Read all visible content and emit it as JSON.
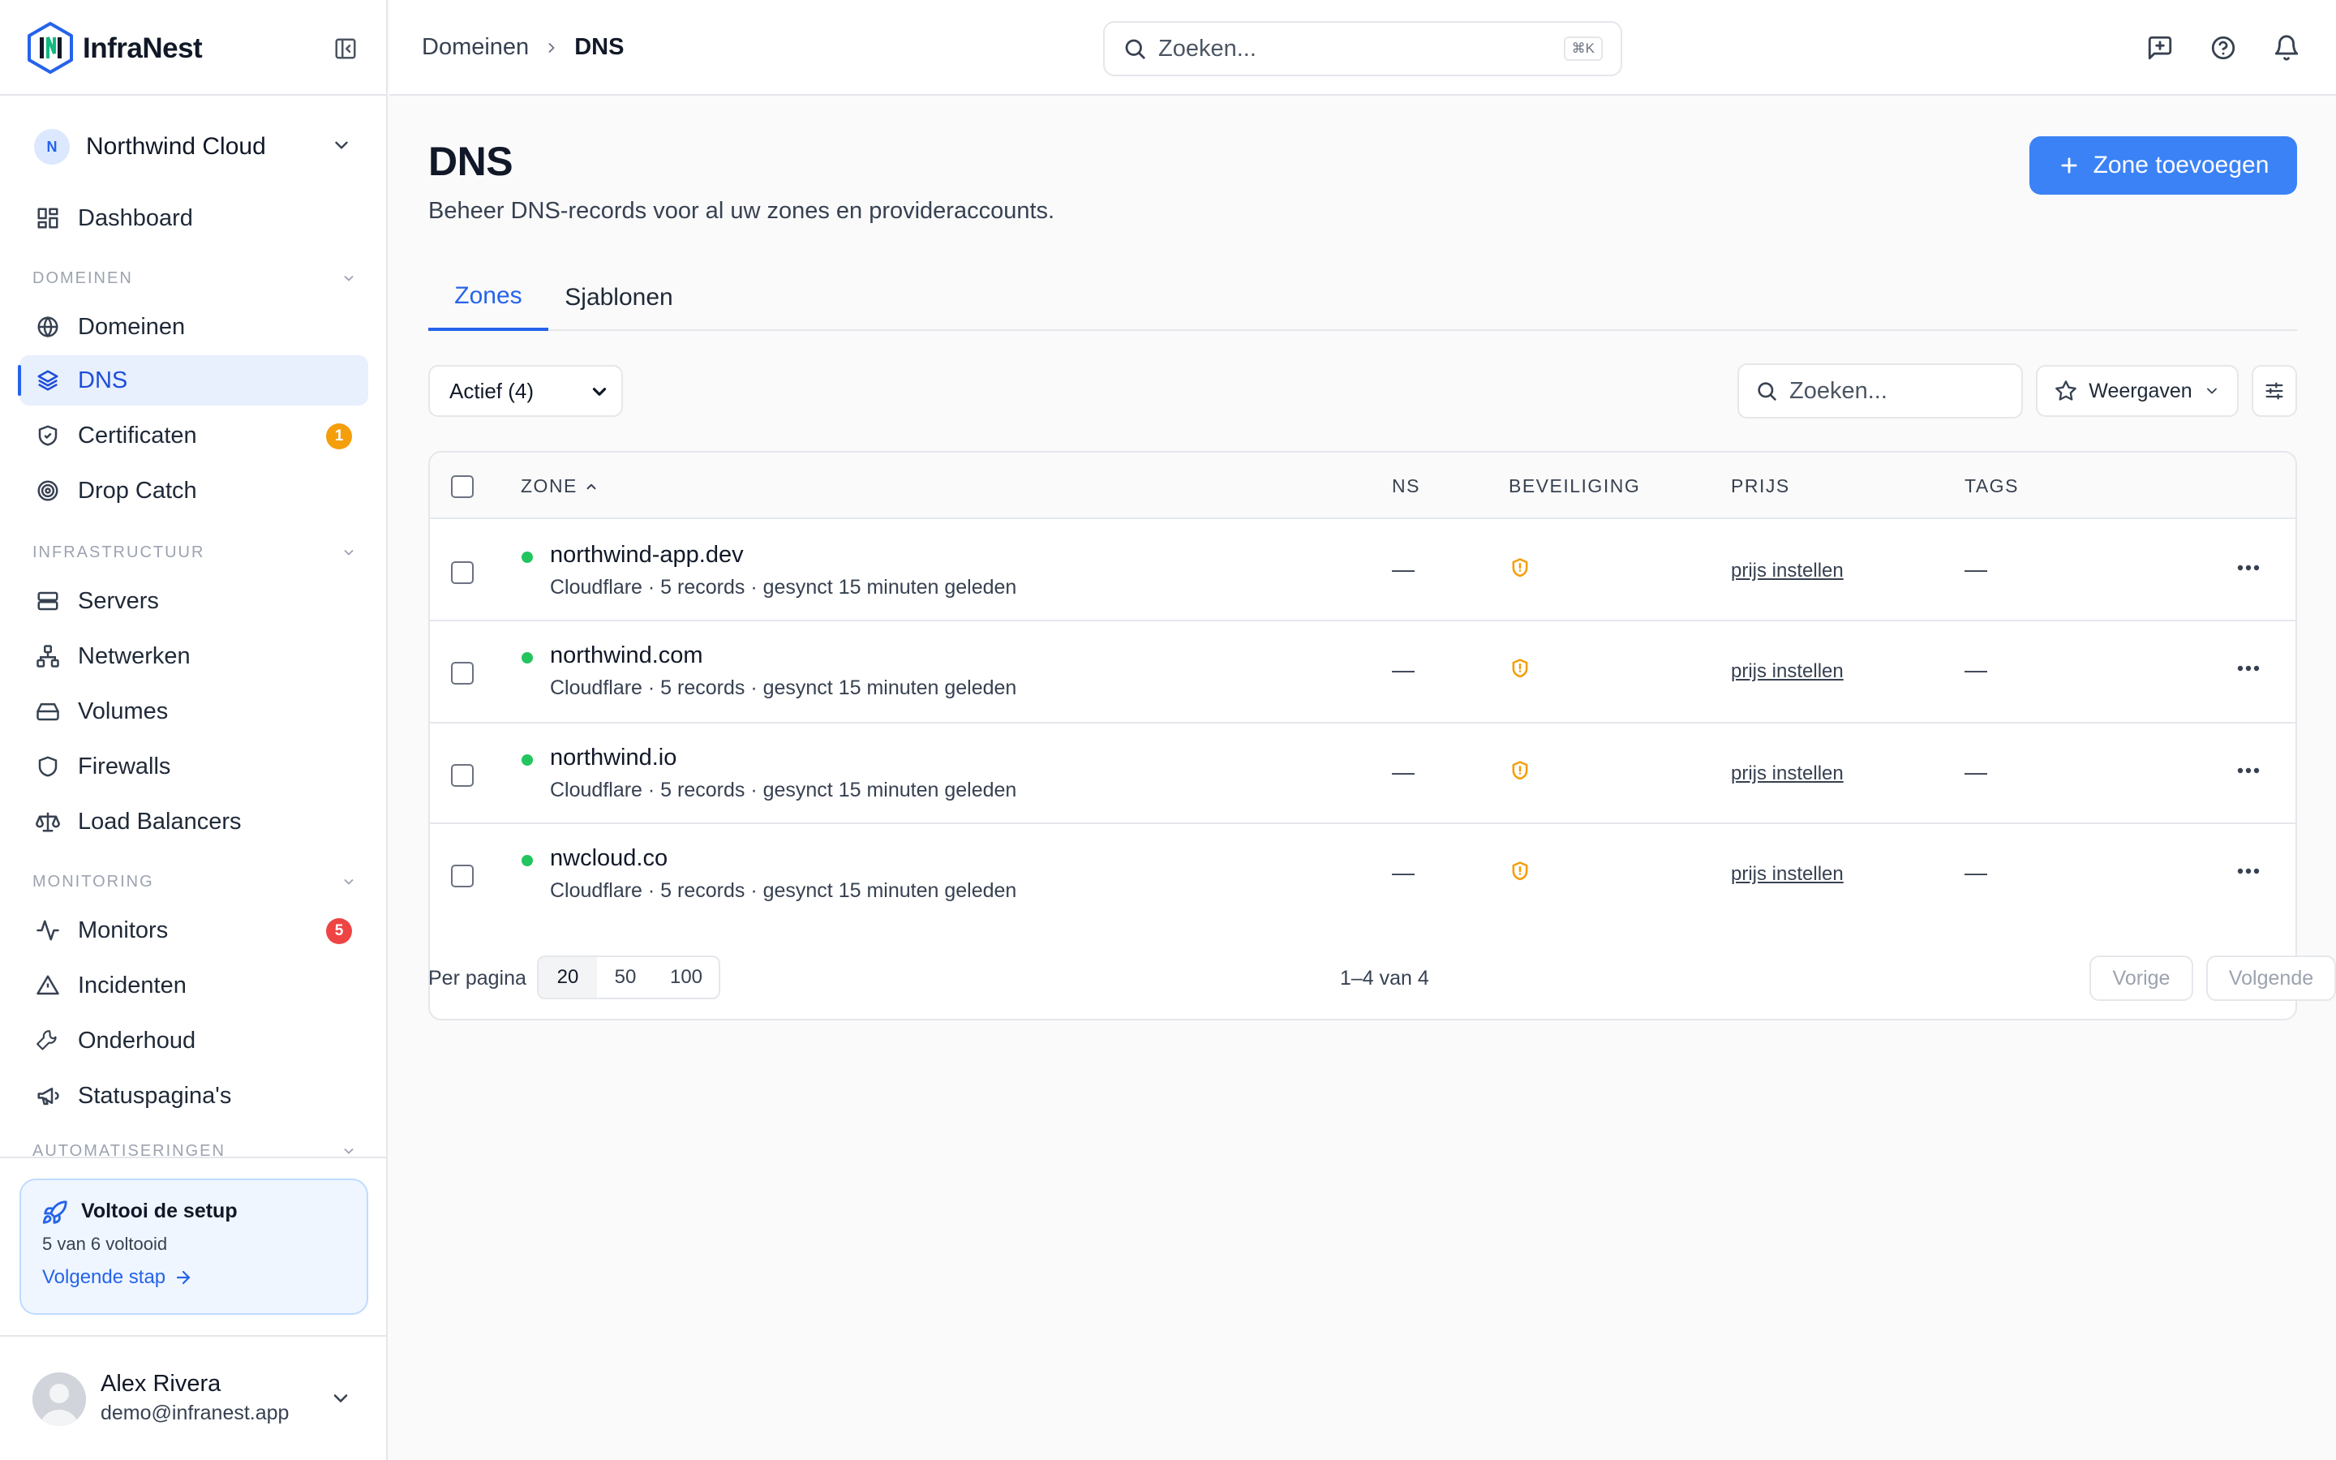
{
  "brand": {
    "name": "InfraNest",
    "accent": "#2563eb"
  },
  "org": {
    "initial": "N",
    "name": "Northwind Cloud"
  },
  "sidebar": {
    "top_item": {
      "label": "Dashboard"
    },
    "sections": [
      {
        "title": "DOMEINEN",
        "items": [
          {
            "label": "Domeinen",
            "icon": "globe-icon"
          },
          {
            "label": "DNS",
            "icon": "layers-icon",
            "active": true
          },
          {
            "label": "Certificaten",
            "icon": "shield-check-icon",
            "badge": "1"
          },
          {
            "label": "Drop Catch",
            "icon": "target-icon"
          }
        ]
      },
      {
        "title": "INFRASTRUCTUUR",
        "items": [
          {
            "label": "Servers",
            "icon": "server-icon"
          },
          {
            "label": "Netwerken",
            "icon": "network-icon"
          },
          {
            "label": "Volumes",
            "icon": "hard-drive-icon"
          },
          {
            "label": "Firewalls",
            "icon": "shield-icon"
          },
          {
            "label": "Load Balancers",
            "icon": "scale-icon"
          }
        ]
      },
      {
        "title": "MONITORING",
        "items": [
          {
            "label": "Monitors",
            "icon": "activity-icon",
            "badge": "5"
          },
          {
            "label": "Incidenten",
            "icon": "alert-triangle-icon"
          },
          {
            "label": "Onderhoud",
            "icon": "wrench-icon"
          },
          {
            "label": "Statuspagina's",
            "icon": "megaphone-icon"
          }
        ]
      },
      {
        "title": "AUTOMATISERINGEN",
        "items": []
      }
    ]
  },
  "setup": {
    "title": "Voltooi de setup",
    "progress": "5 van 6 voltooid",
    "next": "Volgende stap"
  },
  "user": {
    "name": "Alex Rivera",
    "email": "demo@infranest.app"
  },
  "topbar": {
    "breadcrumb": [
      "Domeinen",
      "DNS"
    ],
    "search_placeholder": "Zoeken...",
    "shortcut": "⌘K"
  },
  "page": {
    "title": "DNS",
    "subtitle": "Beheer DNS-records voor al uw zones en provideraccounts.",
    "add_button": "Zone toevoegen",
    "tabs": [
      "Zones",
      "Sjablonen"
    ],
    "active_tab": "Zones"
  },
  "toolbar": {
    "filter_value": "Actief (4)",
    "filter_options": [
      "Actief (4)"
    ],
    "search_placeholder": "Zoeken...",
    "views_label": "Weergaven"
  },
  "table": {
    "columns": [
      "ZONE",
      "NS",
      "BEVEILIGING",
      "PRIJS",
      "TAGS"
    ],
    "rows": [
      {
        "zone": "northwind-app.dev",
        "meta": "Cloudflare · 5 records · gesynct 15 minuten geleden",
        "ns": "—",
        "price": "prijs instellen",
        "tags": "—"
      },
      {
        "zone": "northwind.com",
        "meta": "Cloudflare · 5 records · gesynct 15 minuten geleden",
        "ns": "—",
        "price": "prijs instellen",
        "tags": "—"
      },
      {
        "zone": "northwind.io",
        "meta": "Cloudflare · 5 records · gesynct 15 minuten geleden",
        "ns": "—",
        "price": "prijs instellen",
        "tags": "—"
      },
      {
        "zone": "nwcloud.co",
        "meta": "Cloudflare · 5 records · gesynct 15 minuten geleden",
        "ns": "—",
        "price": "prijs instellen",
        "tags": "—"
      }
    ]
  },
  "pagination": {
    "per_page_label": "Per pagina",
    "options": [
      "20",
      "50",
      "100"
    ],
    "selected": "20",
    "range": "1–4 van 4",
    "prev": "Vorige",
    "next": "Volgende"
  },
  "colors": {
    "primary": "#3b82f6",
    "status_active": "#22c55e",
    "warning": "#f59e0b",
    "danger": "#ef4444"
  }
}
